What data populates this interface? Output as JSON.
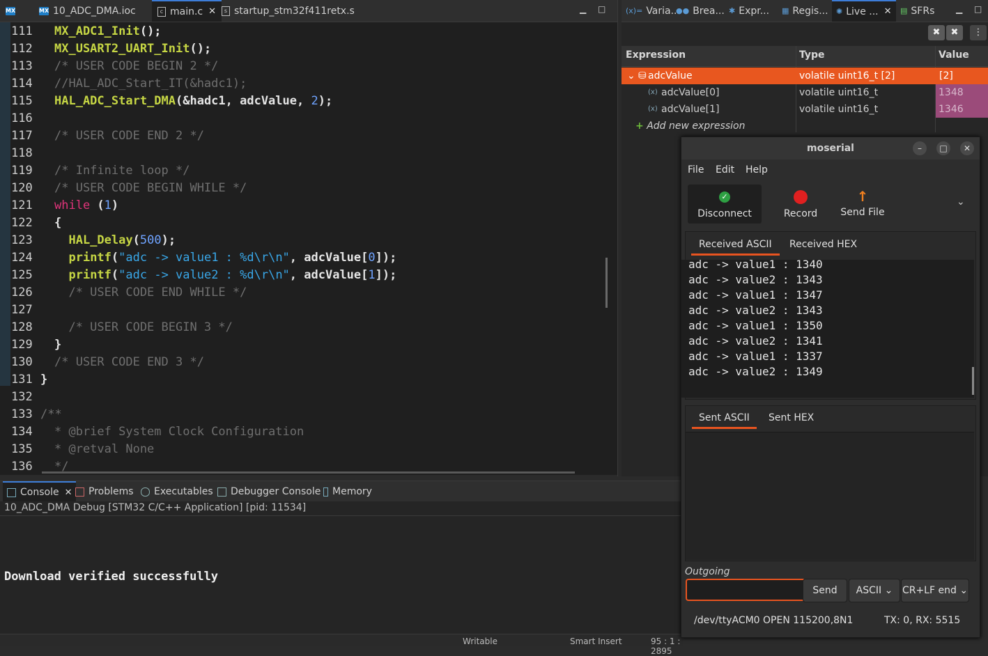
{
  "editor_tabs": [
    {
      "label": "10_ADC_DMA.ioc",
      "icon": "mx-icon"
    },
    {
      "label": "main.c",
      "icon": "c-file-icon"
    },
    {
      "label": "startup_stm32f411retx.s",
      "icon": "s-file-icon"
    }
  ],
  "code_lines": [
    {
      "n": "111",
      "parts": [
        [
          "fn",
          "MX_ADC1_Init"
        ],
        [
          "pl",
          "();"
        ]
      ]
    },
    {
      "n": "112",
      "parts": [
        [
          "fn",
          "MX_USART2_UART_Init"
        ],
        [
          "pl",
          "();"
        ]
      ]
    },
    {
      "n": "113",
      "parts": [
        [
          "cm",
          "/* USER CODE BEGIN 2 */"
        ]
      ]
    },
    {
      "n": "114",
      "parts": [
        [
          "cm",
          "//HAL_ADC_Start_IT(&hadc1);"
        ]
      ]
    },
    {
      "n": "115",
      "parts": [
        [
          "fn",
          "HAL_ADC_Start_DMA"
        ],
        [
          "pl",
          "(&hadc1, adcValue, "
        ],
        [
          "num",
          "2"
        ],
        [
          "pl",
          ");"
        ]
      ]
    },
    {
      "n": "116",
      "parts": []
    },
    {
      "n": "117",
      "parts": [
        [
          "cm",
          "/* USER CODE END 2 */"
        ]
      ]
    },
    {
      "n": "118",
      "parts": []
    },
    {
      "n": "119",
      "parts": [
        [
          "cm",
          "/* Infinite loop */"
        ]
      ]
    },
    {
      "n": "120",
      "parts": [
        [
          "cm",
          "/* USER CODE BEGIN WHILE */"
        ]
      ]
    },
    {
      "n": "121",
      "parts": [
        [
          "kw",
          "while"
        ],
        [
          "pl",
          " ("
        ],
        [
          "num",
          "1"
        ],
        [
          "pl",
          ")"
        ]
      ]
    },
    {
      "n": "122",
      "parts": [
        [
          "pl",
          "{"
        ]
      ]
    },
    {
      "n": "123",
      "parts": [
        [
          "pl",
          "  "
        ],
        [
          "fn",
          "HAL_Delay"
        ],
        [
          "pl",
          "("
        ],
        [
          "num",
          "500"
        ],
        [
          "pl",
          ");"
        ]
      ]
    },
    {
      "n": "124",
      "parts": [
        [
          "pl",
          "  "
        ],
        [
          "fn",
          "printf"
        ],
        [
          "pl",
          "("
        ],
        [
          "str",
          "\"adc -> value1 : %d\\r\\n\""
        ],
        [
          "pl",
          ", adcValue["
        ],
        [
          "num",
          "0"
        ],
        [
          "pl",
          "]);"
        ]
      ]
    },
    {
      "n": "125",
      "parts": [
        [
          "pl",
          "  "
        ],
        [
          "fn",
          "printf"
        ],
        [
          "pl",
          "("
        ],
        [
          "str",
          "\"adc -> value2 : %d\\r\\n\""
        ],
        [
          "pl",
          ", adcValue["
        ],
        [
          "num",
          "1"
        ],
        [
          "pl",
          "]);"
        ]
      ]
    },
    {
      "n": "126",
      "parts": [
        [
          "cm",
          "  /* USER CODE END WHILE */"
        ]
      ]
    },
    {
      "n": "127",
      "parts": []
    },
    {
      "n": "128",
      "parts": [
        [
          "cm",
          "  /* USER CODE BEGIN 3 */"
        ]
      ]
    },
    {
      "n": "129",
      "parts": [
        [
          "pl",
          "}"
        ]
      ]
    },
    {
      "n": "130",
      "parts": [
        [
          "cm",
          "/* USER CODE END 3 */"
        ]
      ]
    },
    {
      "n": "131",
      "parts": [
        [
          "pl",
          "}"
        ]
      ],
      "outdent": true
    },
    {
      "n": "132",
      "parts": []
    },
    {
      "n": "133",
      "parts": [
        [
          "cm",
          "/**"
        ]
      ],
      "outdent": true
    },
    {
      "n": "134",
      "parts": [
        [
          "cm",
          "* @brief System Clock Configuration"
        ]
      ]
    },
    {
      "n": "135",
      "parts": [
        [
          "cm",
          "* @retval None"
        ]
      ]
    },
    {
      "n": "136",
      "parts": [
        [
          "cm",
          "*/"
        ]
      ]
    }
  ],
  "right_tabs": [
    "Varia...",
    "Brea...",
    "Expr...",
    "Regis...",
    "Live ...",
    "SFRs"
  ],
  "expressions": {
    "headers": {
      "expression": "Expression",
      "type": "Type",
      "value": "Value"
    },
    "rows": [
      {
        "name": "adcValue",
        "type": "volatile uint16_t [2]",
        "value": "[2]"
      },
      {
        "name": "adcValue[0]",
        "type": "volatile uint16_t",
        "value": "1348"
      },
      {
        "name": "adcValue[1]",
        "type": "volatile uint16_t",
        "value": "1346"
      }
    ],
    "add_label": "Add new expression"
  },
  "console": {
    "tabs": [
      "Console",
      "Problems",
      "Executables",
      "Debugger Console",
      "Memory"
    ],
    "header": "10_ADC_DMA Debug [STM32 C/C++ Application]  [pid: 11534]",
    "message": "Download verified successfully"
  },
  "statusbar": {
    "writable": "Writable",
    "insert": "Smart Insert",
    "pos": "95 : 1 : 2895"
  },
  "moserial": {
    "title": "moserial",
    "menu": [
      "File",
      "Edit",
      "Help"
    ],
    "toolbar": [
      {
        "label": "Disconnect",
        "icon": "check-icon"
      },
      {
        "label": "Record",
        "icon": "record-icon"
      },
      {
        "label": "Send File",
        "icon": "upload-arrow-icon"
      }
    ],
    "rx_tabs": [
      "Received ASCII",
      "Received HEX"
    ],
    "rx_lines": [
      "adc -> value1 : 1340",
      "adc -> value2 : 1343",
      "adc -> value1 : 1347",
      "adc -> value2 : 1343",
      "adc -> value1 : 1350",
      "adc -> value2 : 1341",
      "adc -> value1 : 1337",
      "adc -> value2 : 1349"
    ],
    "tx_tabs": [
      "Sent ASCII",
      "Sent HEX"
    ],
    "outgoing_label": "Outgoing",
    "outgoing_value": "",
    "send_label": "Send",
    "encoding": "ASCII",
    "line_end": "CR+LF end",
    "status_port": "/dev/ttyACM0 OPEN 115200,8N1",
    "status_counts": "TX: 0, RX: 5515"
  },
  "colors": {
    "accent": "#e8571f",
    "tab_underline": "#e95420",
    "live_value_bg": "#9b4b7a"
  }
}
